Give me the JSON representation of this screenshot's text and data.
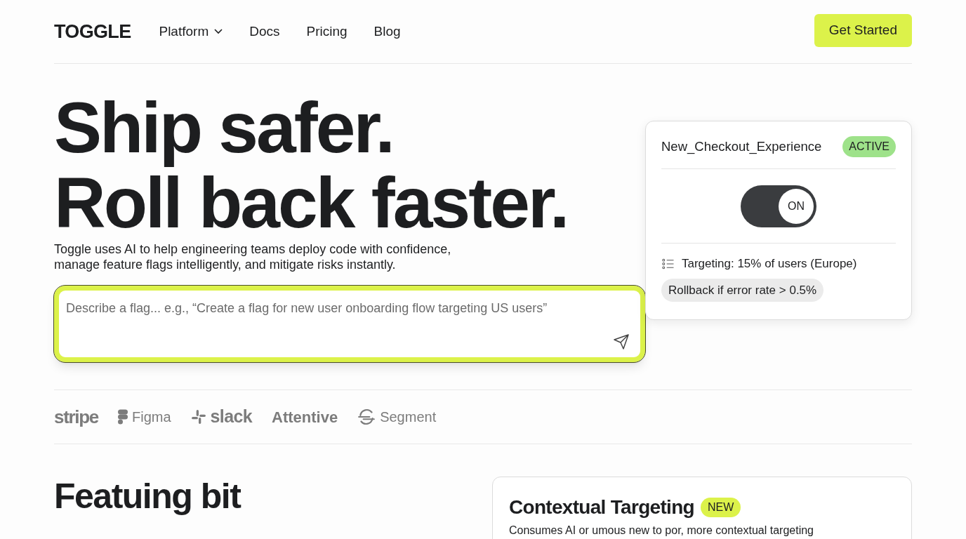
{
  "nav": {
    "logo": "TOGGLE",
    "links": [
      {
        "label": "Platform",
        "dropdown": true
      },
      {
        "label": "Docs",
        "dropdown": false
      },
      {
        "label": "Pricing",
        "dropdown": false
      },
      {
        "label": "Blog",
        "dropdown": false
      }
    ],
    "cta": "Get Started"
  },
  "hero": {
    "headline": [
      "Ship safer.",
      "Roll back faster."
    ],
    "subtitle": "Toggle uses AI to help engineering teams deploy code with confidence,\nmanage feature flags intelligently, and mitigate risks instantly.",
    "prompt": {
      "placeholder": "Describe a flag... e.g., “Create a flag for new user onboarding flow targeting US users”"
    }
  },
  "flag_card": {
    "name": "New_Checkout_Experience",
    "status": "ACTIVE",
    "toggle": {
      "on": true,
      "label": "ON"
    },
    "targeting": "Targeting: 15% of users (Europe)",
    "rule": "Rollback if error rate > 0.5%"
  },
  "logos": [
    {
      "kind": "stripe",
      "label": "stripe"
    },
    {
      "kind": "figma",
      "label": "Figma"
    },
    {
      "kind": "slack",
      "label": "slack"
    },
    {
      "kind": "attentive",
      "label": "Attentive"
    },
    {
      "kind": "segment",
      "label": "Segment"
    }
  ],
  "feature": {
    "heading": "Featuing bit",
    "card": {
      "title": "Contextual Targeting",
      "badge": "NEW",
      "body": "Consumes AI or umous new to por, more contextual targeting"
    }
  }
}
